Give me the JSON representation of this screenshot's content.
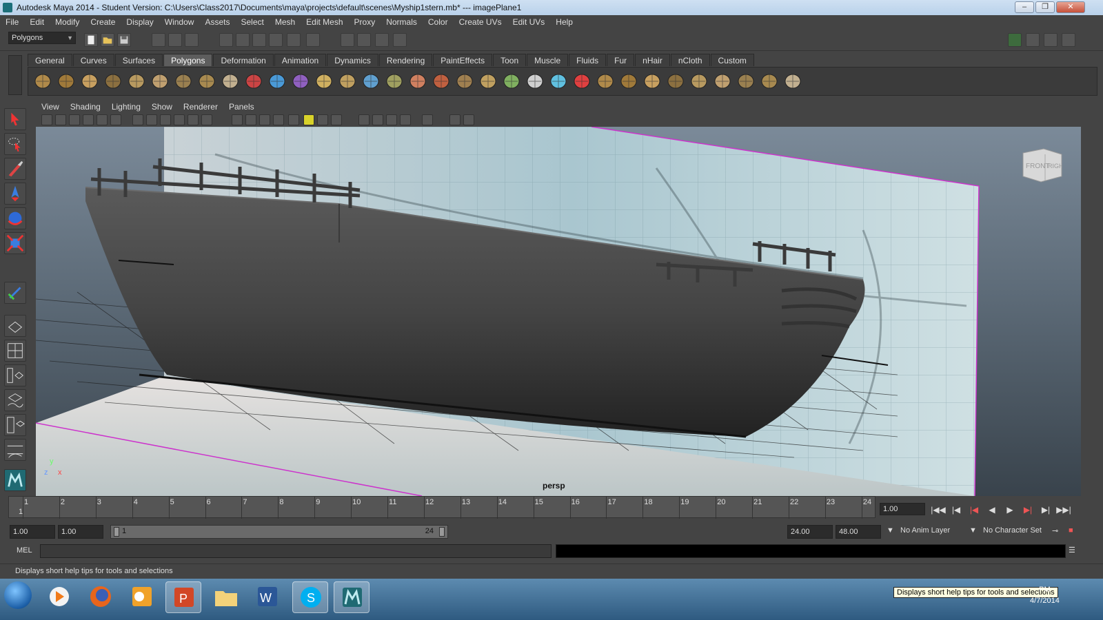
{
  "window": {
    "title": "Autodesk Maya 2014 - Student Version: C:\\Users\\Class2017\\Documents\\maya\\projects\\default\\scenes\\Myship1stern.mb*  ---  imagePlane1"
  },
  "menubar": [
    "File",
    "Edit",
    "Modify",
    "Create",
    "Display",
    "Window",
    "Assets",
    "Select",
    "Mesh",
    "Edit Mesh",
    "Proxy",
    "Normals",
    "Color",
    "Create UVs",
    "Edit UVs",
    "Help"
  ],
  "mode_selector": "Polygons",
  "shelf": {
    "tabs": [
      "General",
      "Curves",
      "Surfaces",
      "Polygons",
      "Deformation",
      "Animation",
      "Dynamics",
      "Rendering",
      "PaintEffects",
      "Toon",
      "Muscle",
      "Fluids",
      "Fur",
      "nHair",
      "nCloth",
      "Custom"
    ],
    "active_tab": "Polygons",
    "tools": [
      "sphere-icon",
      "cube-icon",
      "cylinder-icon",
      "cone-icon",
      "plane-icon",
      "torus-icon",
      "pyramid-icon",
      "pipe-icon",
      "soccer-ball-icon",
      "combine-icon",
      "separate-icon",
      "smooth-icon",
      "cube-select-icon",
      "extrude-icon",
      "bridge-icon",
      "append-icon",
      "split-icon",
      "insert-loop-icon",
      "offset-loop-icon",
      "wedge-icon",
      "bevel-icon",
      "poke-icon",
      "duplicate-face-icon",
      "extract-icon",
      "mirror-icon",
      "triangulate-icon",
      "quadrangulate-icon",
      "sculpt-icon",
      "uv-checker-icon",
      "uv-planar-icon",
      "uv-cylinder-icon",
      "uv-sphere-icon",
      "uv-auto-icon"
    ]
  },
  "panel": {
    "menus": [
      "View",
      "Shading",
      "Lighting",
      "Show",
      "Renderer",
      "Panels"
    ],
    "camera_label": "persp",
    "viewcube": {
      "front": "FRONT",
      "right": "RIGHT"
    },
    "axis": {
      "y": "y",
      "x": "x",
      "z": "z"
    }
  },
  "timeline": {
    "ticks": [
      "1",
      "2",
      "3",
      "4",
      "5",
      "6",
      "7",
      "8",
      "9",
      "10",
      "11",
      "12",
      "13",
      "14",
      "15",
      "16",
      "17",
      "18",
      "19",
      "20",
      "21",
      "22",
      "23",
      "24"
    ],
    "current_frame_indicator": "1",
    "current_time": "1.00",
    "playback_buttons": [
      "go-to-start",
      "step-back-key",
      "step-back",
      "play-back",
      "play-forward",
      "step-forward",
      "step-forward-key",
      "go-to-end"
    ]
  },
  "range": {
    "start_time": "1.00",
    "playback_start": "1.00",
    "slider_start": "1",
    "slider_end": "24",
    "playback_end": "24.00",
    "end_time": "48.00",
    "anim_layer": "No Anim Layer",
    "character_set": "No Character Set"
  },
  "command_line": {
    "label": "MEL"
  },
  "help_line": "Displays short help tips for tools and selections",
  "taskbar": {
    "tooltip": "Displays short help tips for tools and selections",
    "clock_time": "PM",
    "clock_date": "4/7/2014",
    "apps": [
      "windows-media-player-icon",
      "firefox-icon",
      "outlook-icon",
      "powerpoint-icon",
      "file-explorer-icon",
      "word-icon",
      "skype-icon",
      "maya-icon"
    ]
  }
}
